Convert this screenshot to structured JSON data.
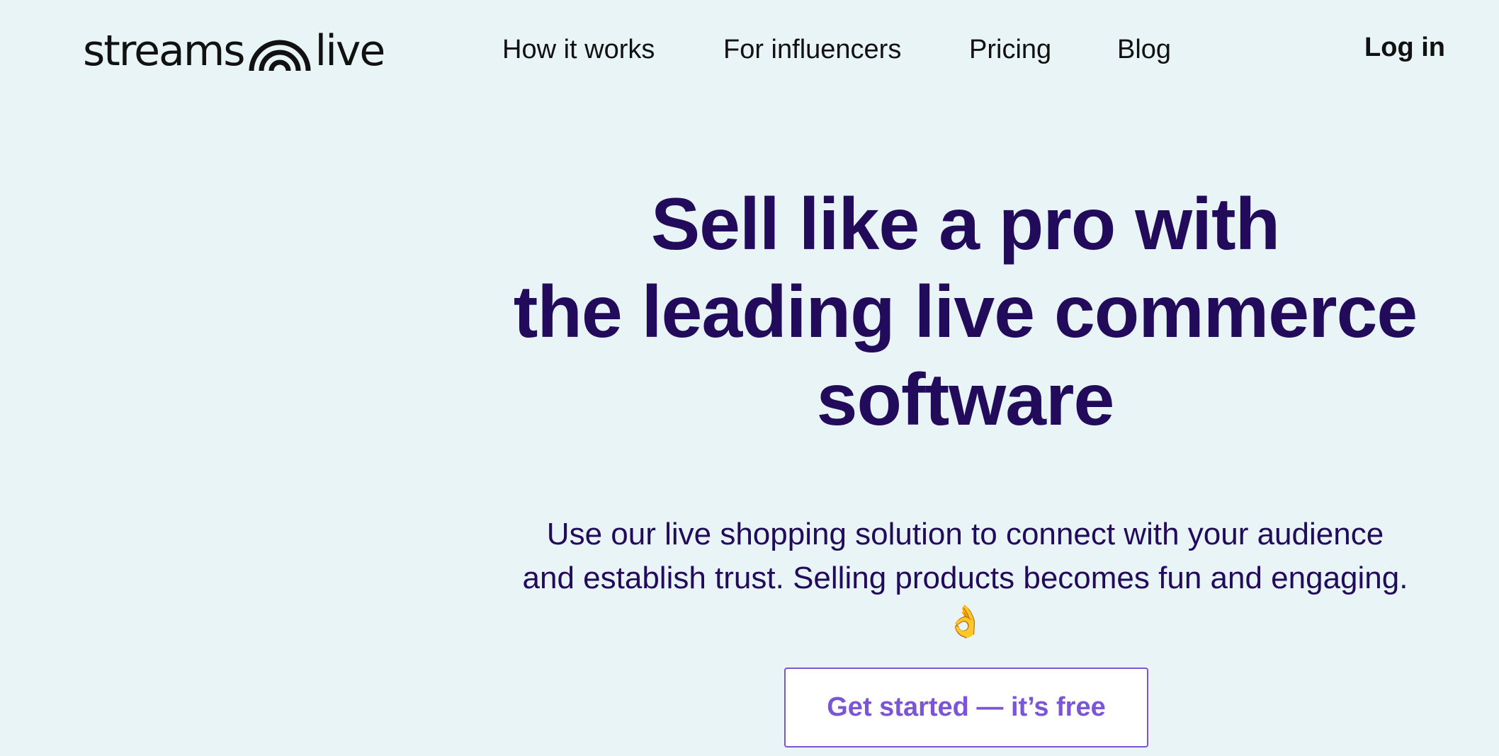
{
  "header": {
    "logo": {
      "text_left": "streams",
      "text_right": "live",
      "icon": "rainbow-arcs-icon"
    },
    "nav": [
      {
        "label": "How it works"
      },
      {
        "label": "For influencers"
      },
      {
        "label": "Pricing"
      },
      {
        "label": "Blog"
      }
    ],
    "login_label": "Log in"
  },
  "hero": {
    "title_lines": [
      "Sell like a pro with",
      "the leading live commerce",
      "software"
    ],
    "subtitle_lines": [
      "Use our live shopping solution to connect with your audience",
      "and establish trust. Selling products becomes fun and engaging."
    ],
    "subtitle_emoji": "👌",
    "cta_label": "Get started — it’s free"
  },
  "colors": {
    "background": "#e8f4f5",
    "heading": "#230b5c",
    "accent": "#7b55d6",
    "nav_text": "#111111"
  }
}
